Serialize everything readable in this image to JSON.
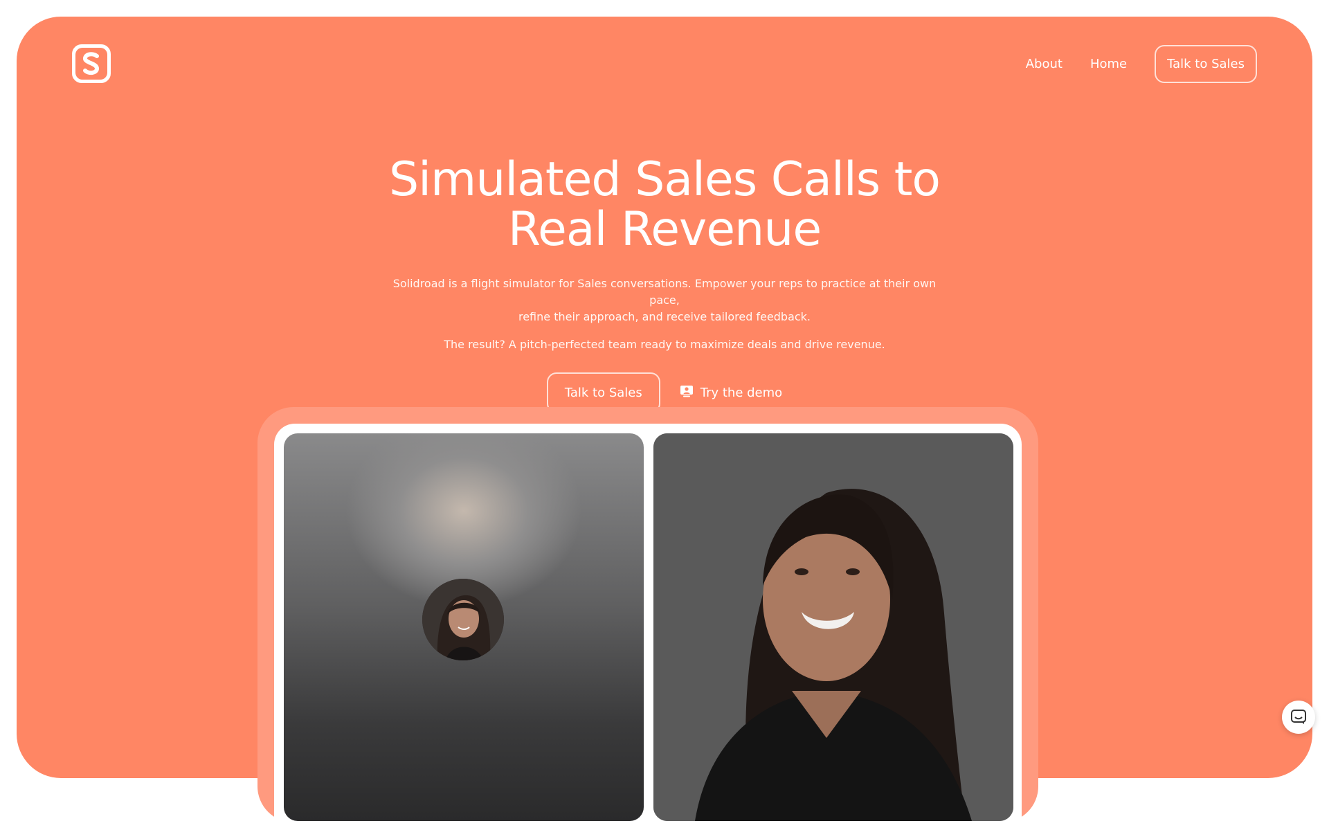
{
  "brand": {
    "logo_icon": "solidroad-s-logo-icon",
    "accent_color": "#FF8664",
    "frame_color": "#FF9A7F"
  },
  "nav": {
    "links": [
      {
        "label": "About"
      },
      {
        "label": "Home"
      }
    ],
    "cta_label": "Talk to Sales"
  },
  "hero": {
    "headline_lines": [
      "Simulated Sales Calls to",
      "Real Revenue"
    ],
    "description_lines": [
      "Solidroad is a flight simulator for Sales conversations. Empower your reps to practice at their own pace,",
      "refine their approach, and receive tailored feedback."
    ],
    "result": "The result? A pitch-perfected team ready to maximize deals and drive revenue.",
    "primary_cta": "Talk to Sales",
    "secondary_cta": "Try the demo",
    "secondary_cta_icon": "user-presentation-icon"
  },
  "video_call": {
    "left_tile_icon": "caller-avatar-photo",
    "right_tile_icon": "participant-video-photo"
  },
  "support": {
    "icon": "chat-support-icon"
  }
}
